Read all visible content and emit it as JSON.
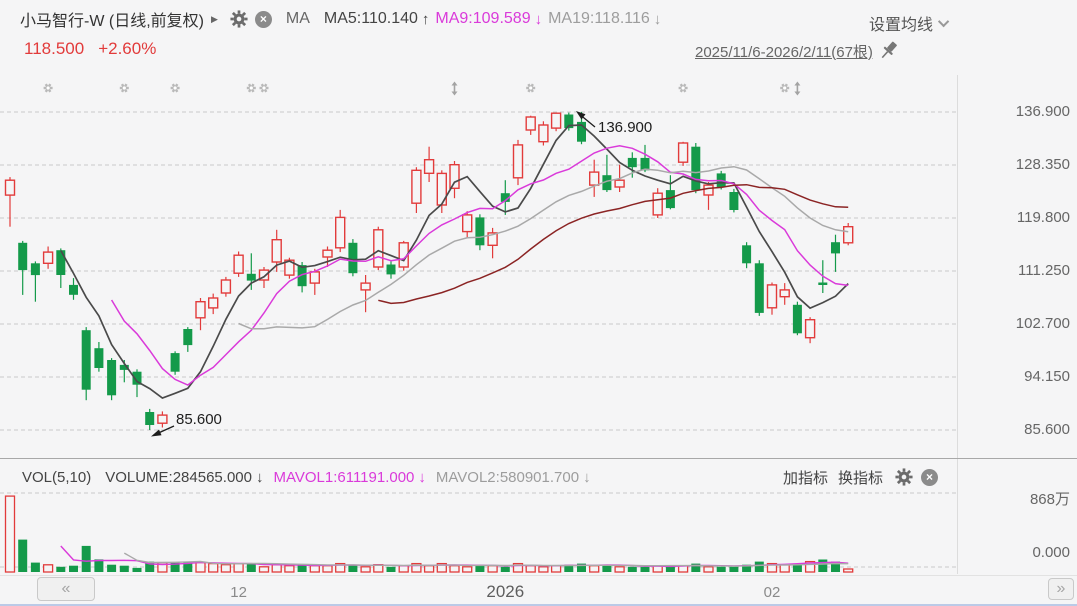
{
  "header": {
    "title": "小马智行-W (日线,前复权)",
    "ma_group_label": "MA",
    "ma5_label": "MA5:110.140",
    "ma5_arrow": "↑",
    "ma9_label": "MA9:109.589",
    "ma9_arrow": "↓",
    "ma19_label": "MA19:118.116",
    "ma19_arrow": "↓",
    "ma_settings_label": "设置均线",
    "last_price": "118.500",
    "change_percent": "+2.60%",
    "visible_range": "2025/11/6-2026/2/11(67根)"
  },
  "volume_header": {
    "vol_label": "VOL(5,10)",
    "volume_label": "VOLUME:284565.000",
    "volume_arrow": "↓",
    "mavol1_label": "MAVOL1:611191.000",
    "mavol1_arrow": "↓",
    "mavol2_label": "MAVOL2:580901.700",
    "mavol2_arrow": "↓",
    "add_indicator_label": "加指标",
    "switch_indicator_label": "换指标"
  },
  "price_axis_labels": [
    "136.900",
    "128.350",
    "119.800",
    "111.250",
    "102.700",
    "94.150",
    "85.600"
  ],
  "volume_axis": {
    "max_label": "868万",
    "zero_label": "0.000"
  },
  "scrollbar": {
    "left_label": "«",
    "right_label": "»"
  },
  "icons": {
    "expand": "▶",
    "close_glyph": "×",
    "gear": "gear-icon",
    "chevron": "chevron-down-icon",
    "pin": "pushpin-icon",
    "event_flower": "flower-marker-icon",
    "event_updown": "updown-arrow-icon"
  },
  "colors": {
    "bg": "#f5f5f6",
    "up": "#e23b3b",
    "down": "#149a4a",
    "ma5": "#4a4a4a",
    "ma9": "#da3ada",
    "ma19": "#a9a9a9",
    "ma30": "#8b2424",
    "grid": "#c9c9c9",
    "annotation": "#1d1d1d",
    "marker": "#b9b9b9"
  },
  "chart_data": {
    "type": "candlestick",
    "instrument": "小马智行-W",
    "period": "日线",
    "adjustment": "前复权",
    "candle_count": 67,
    "date_range": "2025/11/6-2026/2/11",
    "price_gridlines": [
      136.9,
      128.35,
      119.8,
      111.25,
      102.7,
      94.15,
      85.6
    ],
    "volume_axis_max_wan": 868,
    "annotations": {
      "high": "136.900",
      "low": "85.600",
      "high_index": 45,
      "low_index": 11
    },
    "x_ticks": [
      {
        "label": "12",
        "index": 18,
        "major": false
      },
      {
        "label": "2026",
        "index": 39,
        "major": true
      },
      {
        "label": "02",
        "index": 60,
        "major": false
      }
    ],
    "moving_averages": [
      {
        "name": "MA5",
        "period": 5,
        "color": "#4a4a4a"
      },
      {
        "name": "MA9",
        "period": 9,
        "color": "#da3ada"
      },
      {
        "name": "MA19",
        "period": 19,
        "color": "#a9a9a9"
      },
      {
        "name": "MA30",
        "period": 30,
        "color": "#8b2424"
      }
    ],
    "volume_mas": [
      {
        "name": "MAVOL1",
        "period": 5,
        "color": "#da3ada"
      },
      {
        "name": "MAVOL2",
        "period": 10,
        "color": "#a9a9a9"
      }
    ],
    "event_markers": [
      {
        "type": "flower",
        "index": 3
      },
      {
        "type": "flower",
        "index": 9
      },
      {
        "type": "flower",
        "index": 13
      },
      {
        "type": "flower",
        "index": 19
      },
      {
        "type": "flower",
        "index": 20
      },
      {
        "type": "updown",
        "index": 35
      },
      {
        "type": "flower",
        "index": 41
      },
      {
        "type": "flower",
        "index": 53
      },
      {
        "type": "flower",
        "index": 61
      },
      {
        "type": "updown",
        "index": 62
      }
    ],
    "candles": [
      [
        123.5,
        126.4,
        118.4,
        125.9,
        845
      ],
      [
        115.8,
        116.1,
        107.4,
        111.4,
        360
      ],
      [
        112.5,
        112.8,
        106.3,
        110.6,
        105
      ],
      [
        112.5,
        115.2,
        111.6,
        114.3,
        80
      ],
      [
        114.6,
        114.9,
        108.5,
        110.6,
        58
      ],
      [
        109.0,
        110.1,
        106.6,
        107.4,
        70
      ],
      [
        101.7,
        102.2,
        90.4,
        92.1,
        290
      ],
      [
        98.8,
        99.8,
        95.0,
        95.6,
        140
      ],
      [
        96.9,
        97.2,
        90.4,
        91.2,
        81
      ],
      [
        96.1,
        96.9,
        93.3,
        95.3,
        70
      ],
      [
        95.0,
        95.4,
        90.9,
        92.9,
        46
      ],
      [
        88.5,
        89.0,
        85.6,
        86.4,
        116
      ],
      [
        86.7,
        88.6,
        86.0,
        88.0,
        105
      ],
      [
        98.0,
        98.3,
        94.5,
        95.0,
        105
      ],
      [
        101.9,
        102.2,
        98.2,
        99.3,
        105
      ],
      [
        103.7,
        106.9,
        101.7,
        106.3,
        105
      ],
      [
        105.3,
        107.6,
        104.3,
        106.9,
        93
      ],
      [
        107.7,
        110.3,
        107.1,
        109.8,
        81
      ],
      [
        110.9,
        114.4,
        110.3,
        113.8,
        93
      ],
      [
        110.8,
        114.1,
        108.2,
        109.7,
        93
      ],
      [
        109.8,
        111.9,
        108.5,
        111.4,
        58
      ],
      [
        112.7,
        117.9,
        111.1,
        116.3,
        81
      ],
      [
        110.6,
        113.4,
        110.0,
        113.0,
        70
      ],
      [
        112.2,
        112.7,
        107.8,
        108.8,
        81
      ],
      [
        109.3,
        111.6,
        107.4,
        111.1,
        70
      ],
      [
        113.5,
        115.2,
        111.9,
        114.6,
        70
      ],
      [
        115.0,
        121.1,
        114.3,
        119.9,
        93
      ],
      [
        115.8,
        116.4,
        110.4,
        110.9,
        81
      ],
      [
        108.2,
        110.6,
        104.6,
        109.3,
        58
      ],
      [
        111.9,
        118.4,
        111.4,
        117.9,
        81
      ],
      [
        112.3,
        112.8,
        110.0,
        110.7,
        58
      ],
      [
        111.9,
        116.1,
        111.3,
        115.8,
        70
      ],
      [
        122.2,
        128.0,
        120.6,
        127.5,
        93
      ],
      [
        127.0,
        131.3,
        125.6,
        129.2,
        70
      ],
      [
        121.9,
        127.5,
        120.6,
        127.0,
        93
      ],
      [
        124.6,
        129.0,
        123.0,
        128.4,
        70
      ],
      [
        117.6,
        120.9,
        116.6,
        120.3,
        58
      ],
      [
        119.9,
        120.4,
        114.6,
        115.4,
        81
      ],
      [
        115.4,
        118.2,
        113.3,
        117.4,
        70
      ],
      [
        123.8,
        125.9,
        120.3,
        122.4,
        58
      ],
      [
        126.3,
        132.4,
        125.1,
        131.6,
        93
      ],
      [
        134.0,
        136.3,
        133.2,
        136.1,
        70
      ],
      [
        132.1,
        135.4,
        131.5,
        134.8,
        58
      ],
      [
        134.3,
        136.8,
        133.8,
        136.7,
        70
      ],
      [
        136.5,
        136.8,
        133.9,
        134.3,
        81
      ],
      [
        135.3,
        136.9,
        131.7,
        132.1,
        93
      ],
      [
        125.1,
        129.2,
        123.2,
        127.2,
        70
      ],
      [
        126.7,
        130.0,
        124.0,
        124.3,
        81
      ],
      [
        124.8,
        128.4,
        124.0,
        125.9,
        58
      ],
      [
        129.5,
        130.4,
        126.3,
        128.0,
        58
      ],
      [
        129.5,
        131.6,
        127.2,
        127.5,
        58
      ],
      [
        120.3,
        124.6,
        119.8,
        123.8,
        70
      ],
      [
        124.3,
        126.7,
        121.2,
        121.4,
        70
      ],
      [
        128.8,
        132.1,
        128.2,
        131.9,
        70
      ],
      [
        131.3,
        131.9,
        123.8,
        124.3,
        93
      ],
      [
        123.5,
        125.6,
        121.1,
        125.1,
        58
      ],
      [
        127.0,
        127.4,
        124.4,
        124.8,
        58
      ],
      [
        124.0,
        124.5,
        120.7,
        121.1,
        58
      ],
      [
        115.4,
        115.9,
        111.7,
        112.5,
        81
      ],
      [
        112.5,
        113.0,
        104.0,
        104.5,
        116
      ],
      [
        105.3,
        109.4,
        104.2,
        109.0,
        93
      ],
      [
        107.1,
        109.3,
        105.8,
        108.2,
        81
      ],
      [
        105.8,
        106.3,
        100.9,
        101.2,
        93
      ],
      [
        100.5,
        103.8,
        99.6,
        103.4,
        116
      ],
      [
        109.4,
        113.0,
        107.7,
        109.0,
        139
      ],
      [
        115.9,
        117.1,
        111.1,
        114.1,
        116
      ],
      [
        115.8,
        119.0,
        115.4,
        118.4,
        28
      ]
    ]
  }
}
